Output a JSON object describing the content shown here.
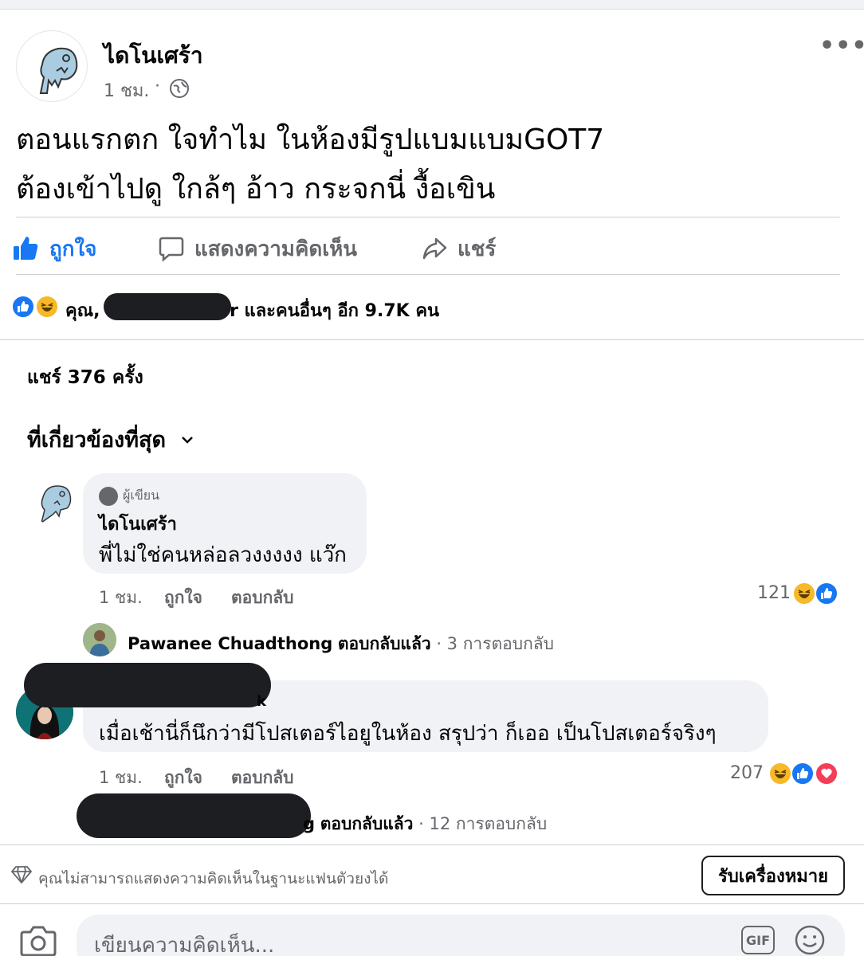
{
  "post": {
    "author": "ไดโนเศร้า",
    "time": "1 ชม.",
    "text_line1": "ตอนแรกตก ใจทำไม ในห้องมีรูปแบมแบมGOT7",
    "text_line2": "ต้องเข้าไปดู ใกล้ๆ อ้าว กระจกนี่ งื้อเขิน"
  },
  "actions": {
    "like": "ถูกใจ",
    "comment": "แสดงความคิดเห็น",
    "share": "แชร์"
  },
  "reactions_summary": {
    "you": "คุณ,",
    "others": "r และคนอื่นๆ อีก 9.7K คน"
  },
  "shares": "แชร์ 376 ครั้ง",
  "sort_label": "ที่เกี่ยวข้องที่สุด",
  "comments": [
    {
      "badge": "ผู้เขียน",
      "author": "ไดโนเศร้า",
      "text": "พี่ไม่ใช่คนหล่อลวงงงงง แว๊ก",
      "time": "1 ชม.",
      "like": "ถูกใจ",
      "reply": "ตอบกลับ",
      "count": "121",
      "reply_summary": {
        "name": "Pawanee Chuadthong",
        "action": "ตอบกลับแล้ว",
        "count": "· 3 การตอบกลับ"
      }
    },
    {
      "author_tail": "k",
      "text": "เมื่อเช้านี่ก็นึกว่ามีโปสเตอร์ไอยูในห้อง สรุปว่า ก็เออ เป็นโปสเตอร์จริงๆ",
      "time": "1 ชม.",
      "like": "ถูกใจ",
      "reply": "ตอบกลับ",
      "count": "207",
      "reply_summary": {
        "name_tail": "g",
        "action": "ตอบกลับแล้ว",
        "count": "· 12 การตอบกลับ"
      }
    }
  ],
  "notice": {
    "text": "คุณไม่สามารถแสดงความคิดเห็นในฐานะแฟนตัวยงได้",
    "button": "รับเครื่องหมาย"
  },
  "composer": {
    "placeholder": "เขียนความคิดเห็น...",
    "gif": "GIF"
  },
  "colors": {
    "facebook_blue": "#1877f2",
    "haha_yellow": "#f7b928",
    "love_red": "#f33e58",
    "secondary_text": "#65676b",
    "bubble_bg": "#f0f2f5"
  },
  "icons": [
    "globe-icon",
    "more-icon",
    "thumbs-up-icon",
    "comment-icon",
    "share-icon",
    "haha-icon",
    "love-icon",
    "chevron-down-icon",
    "diamond-icon",
    "camera-icon",
    "gif-icon",
    "emoji-icon"
  ]
}
